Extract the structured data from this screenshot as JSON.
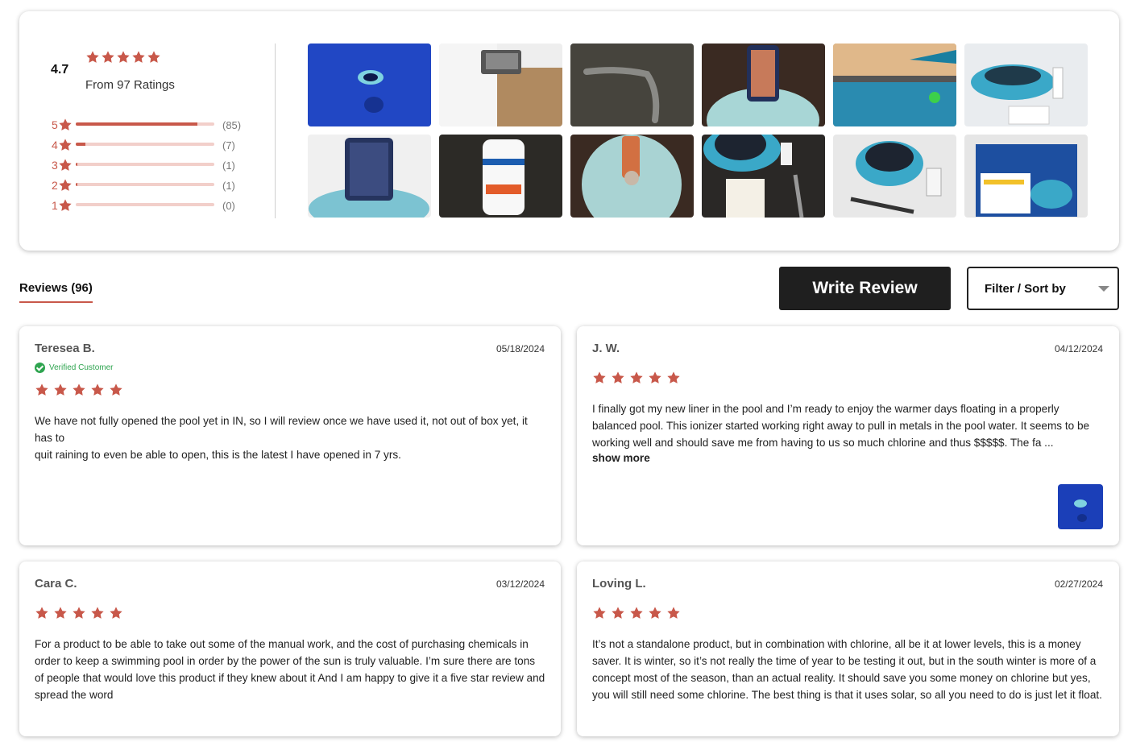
{
  "summary": {
    "average": "4.7",
    "from_text": "From 97 Ratings",
    "distribution": [
      {
        "stars": "5",
        "count": "(85)",
        "fraction": 0.876
      },
      {
        "stars": "4",
        "count": "(7)",
        "fraction": 0.072
      },
      {
        "stars": "3",
        "count": "(1)",
        "fraction": 0.01
      },
      {
        "stars": "2",
        "count": "(1)",
        "fraction": 0.01
      },
      {
        "stars": "1",
        "count": "(0)",
        "fraction": 0
      }
    ],
    "photos": [
      {
        "icon": "pool-ionizer-floating-photo"
      },
      {
        "icon": "packaging-brush-photo"
      },
      {
        "icon": "brush-on-granite-photo"
      },
      {
        "icon": "copper-basket-photo"
      },
      {
        "icon": "backyard-pool-photo"
      },
      {
        "icon": "ionizer-with-bottle-photo"
      },
      {
        "icon": "basket-in-foam-photo"
      },
      {
        "icon": "test-strips-bottle-photo"
      },
      {
        "icon": "copper-anode-photo"
      },
      {
        "icon": "solar-panel-kit-photo"
      },
      {
        "icon": "ionizer-counter-photo"
      },
      {
        "icon": "product-box-photo"
      }
    ]
  },
  "tabs": {
    "reviews_label": "Reviews (96)"
  },
  "actions": {
    "write_review": "Write Review",
    "filter_sort": "Filter / Sort by"
  },
  "reviews": [
    {
      "name": "Teresea B.",
      "date": "05/18/2024",
      "verified": "Verified Customer",
      "rating": 5,
      "body_lines": [
        "We have not fully opened  the pool yet in IN, so I will review once we have used it, not out of box yet, it has to",
        "quit raining to even be able to open, this is the latest I have opened in 7 yrs."
      ]
    },
    {
      "name": "J. W.",
      "date": "04/12/2024",
      "rating": 5,
      "body": "I finally got my new liner in the pool and I’m ready to enjoy the warmer days floating in a properly balanced pool.  This ionizer started working right away to pull in metals in the pool water.  It seems to be working well and should save me from having to us so much chlorine and thus $$$$$.  The fa ...",
      "show_more": "show more"
    },
    {
      "name": "Cara C.",
      "date": "03/12/2024",
      "rating": 5,
      "body": "For a product to be able to take out some of the manual work, and the cost of purchasing chemicals in order to keep a swimming pool in order by the power of the sun is truly valuable. I’m sure there are tons of people that would love this product if they knew about it And I am happy to give it a five star review and spread the word"
    },
    {
      "name": "Loving L.",
      "date": "02/27/2024",
      "rating": 5,
      "body": "It’s not a standalone product, but in combination with chlorine, all be it at lower levels, this is a money saver. It is winter, so it’s not really the time of year to be testing it out, but in the south winter is more of a concept most of the season, than an actual reality. It should save you some money on chlorine but yes, you will still need some chlorine. The best thing is that it uses solar, so all you need to do is just let it float."
    }
  ],
  "colors": {
    "star": "#c8584a",
    "bar_bg": "#f2cfca",
    "verified": "#2ea44f",
    "button_bg": "#1f1f1f"
  }
}
